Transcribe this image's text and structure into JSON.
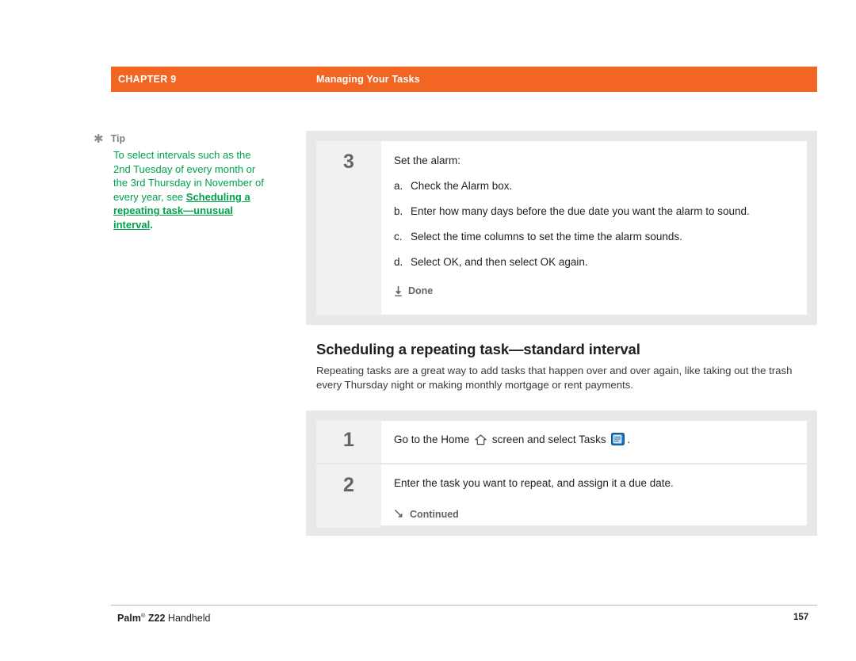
{
  "header": {
    "chapter": "CHAPTER 9",
    "title": "Managing Your Tasks"
  },
  "tip": {
    "label": "Tip",
    "text_before": "To select intervals such as the 2nd Tuesday of every month or the 3rd Thursday in November of every year, see ",
    "link_text": "Scheduling a repeating task—unusual interval",
    "text_after": "."
  },
  "panels": {
    "step3": {
      "number": "3",
      "intro": "Set the alarm:",
      "substeps": [
        {
          "letter": "a.",
          "text": "Check the Alarm box."
        },
        {
          "letter": "b.",
          "text": "Enter how many days before the due date you want the alarm to sound."
        },
        {
          "letter": "c.",
          "text": "Select the time columns to set the time the alarm sounds."
        },
        {
          "letter": "d.",
          "text": "Select OK, and then select OK again."
        }
      ],
      "done_label": "Done",
      "done_icon": "down-arrow-icon"
    },
    "step1": {
      "number": "1",
      "text_part1": "Go to the Home ",
      "home_icon": "home-icon",
      "text_part2": " screen and select Tasks ",
      "tasks_icon": "tasks-app-icon",
      "text_part3": "."
    },
    "step2": {
      "number": "2",
      "text": "Enter the task you want to repeat, and assign it a due date.",
      "continued_label": "Continued",
      "continued_icon": "down-right-arrow-icon"
    }
  },
  "section": {
    "heading": "Scheduling a repeating task—standard interval",
    "intro": "Repeating tasks are a great way to add tasks that happen over and over again, like taking out the trash every Thursday night or making monthly mortgage or rent payments."
  },
  "footer": {
    "brand": "Palm",
    "registered": "®",
    "product": " Z22",
    "suffix": " Handheld",
    "page": "157"
  },
  "colors": {
    "accent": "#f26522",
    "tip_green": "#00a14b",
    "panel_gray": "#e8e8e8",
    "num_gray": "#636466"
  }
}
